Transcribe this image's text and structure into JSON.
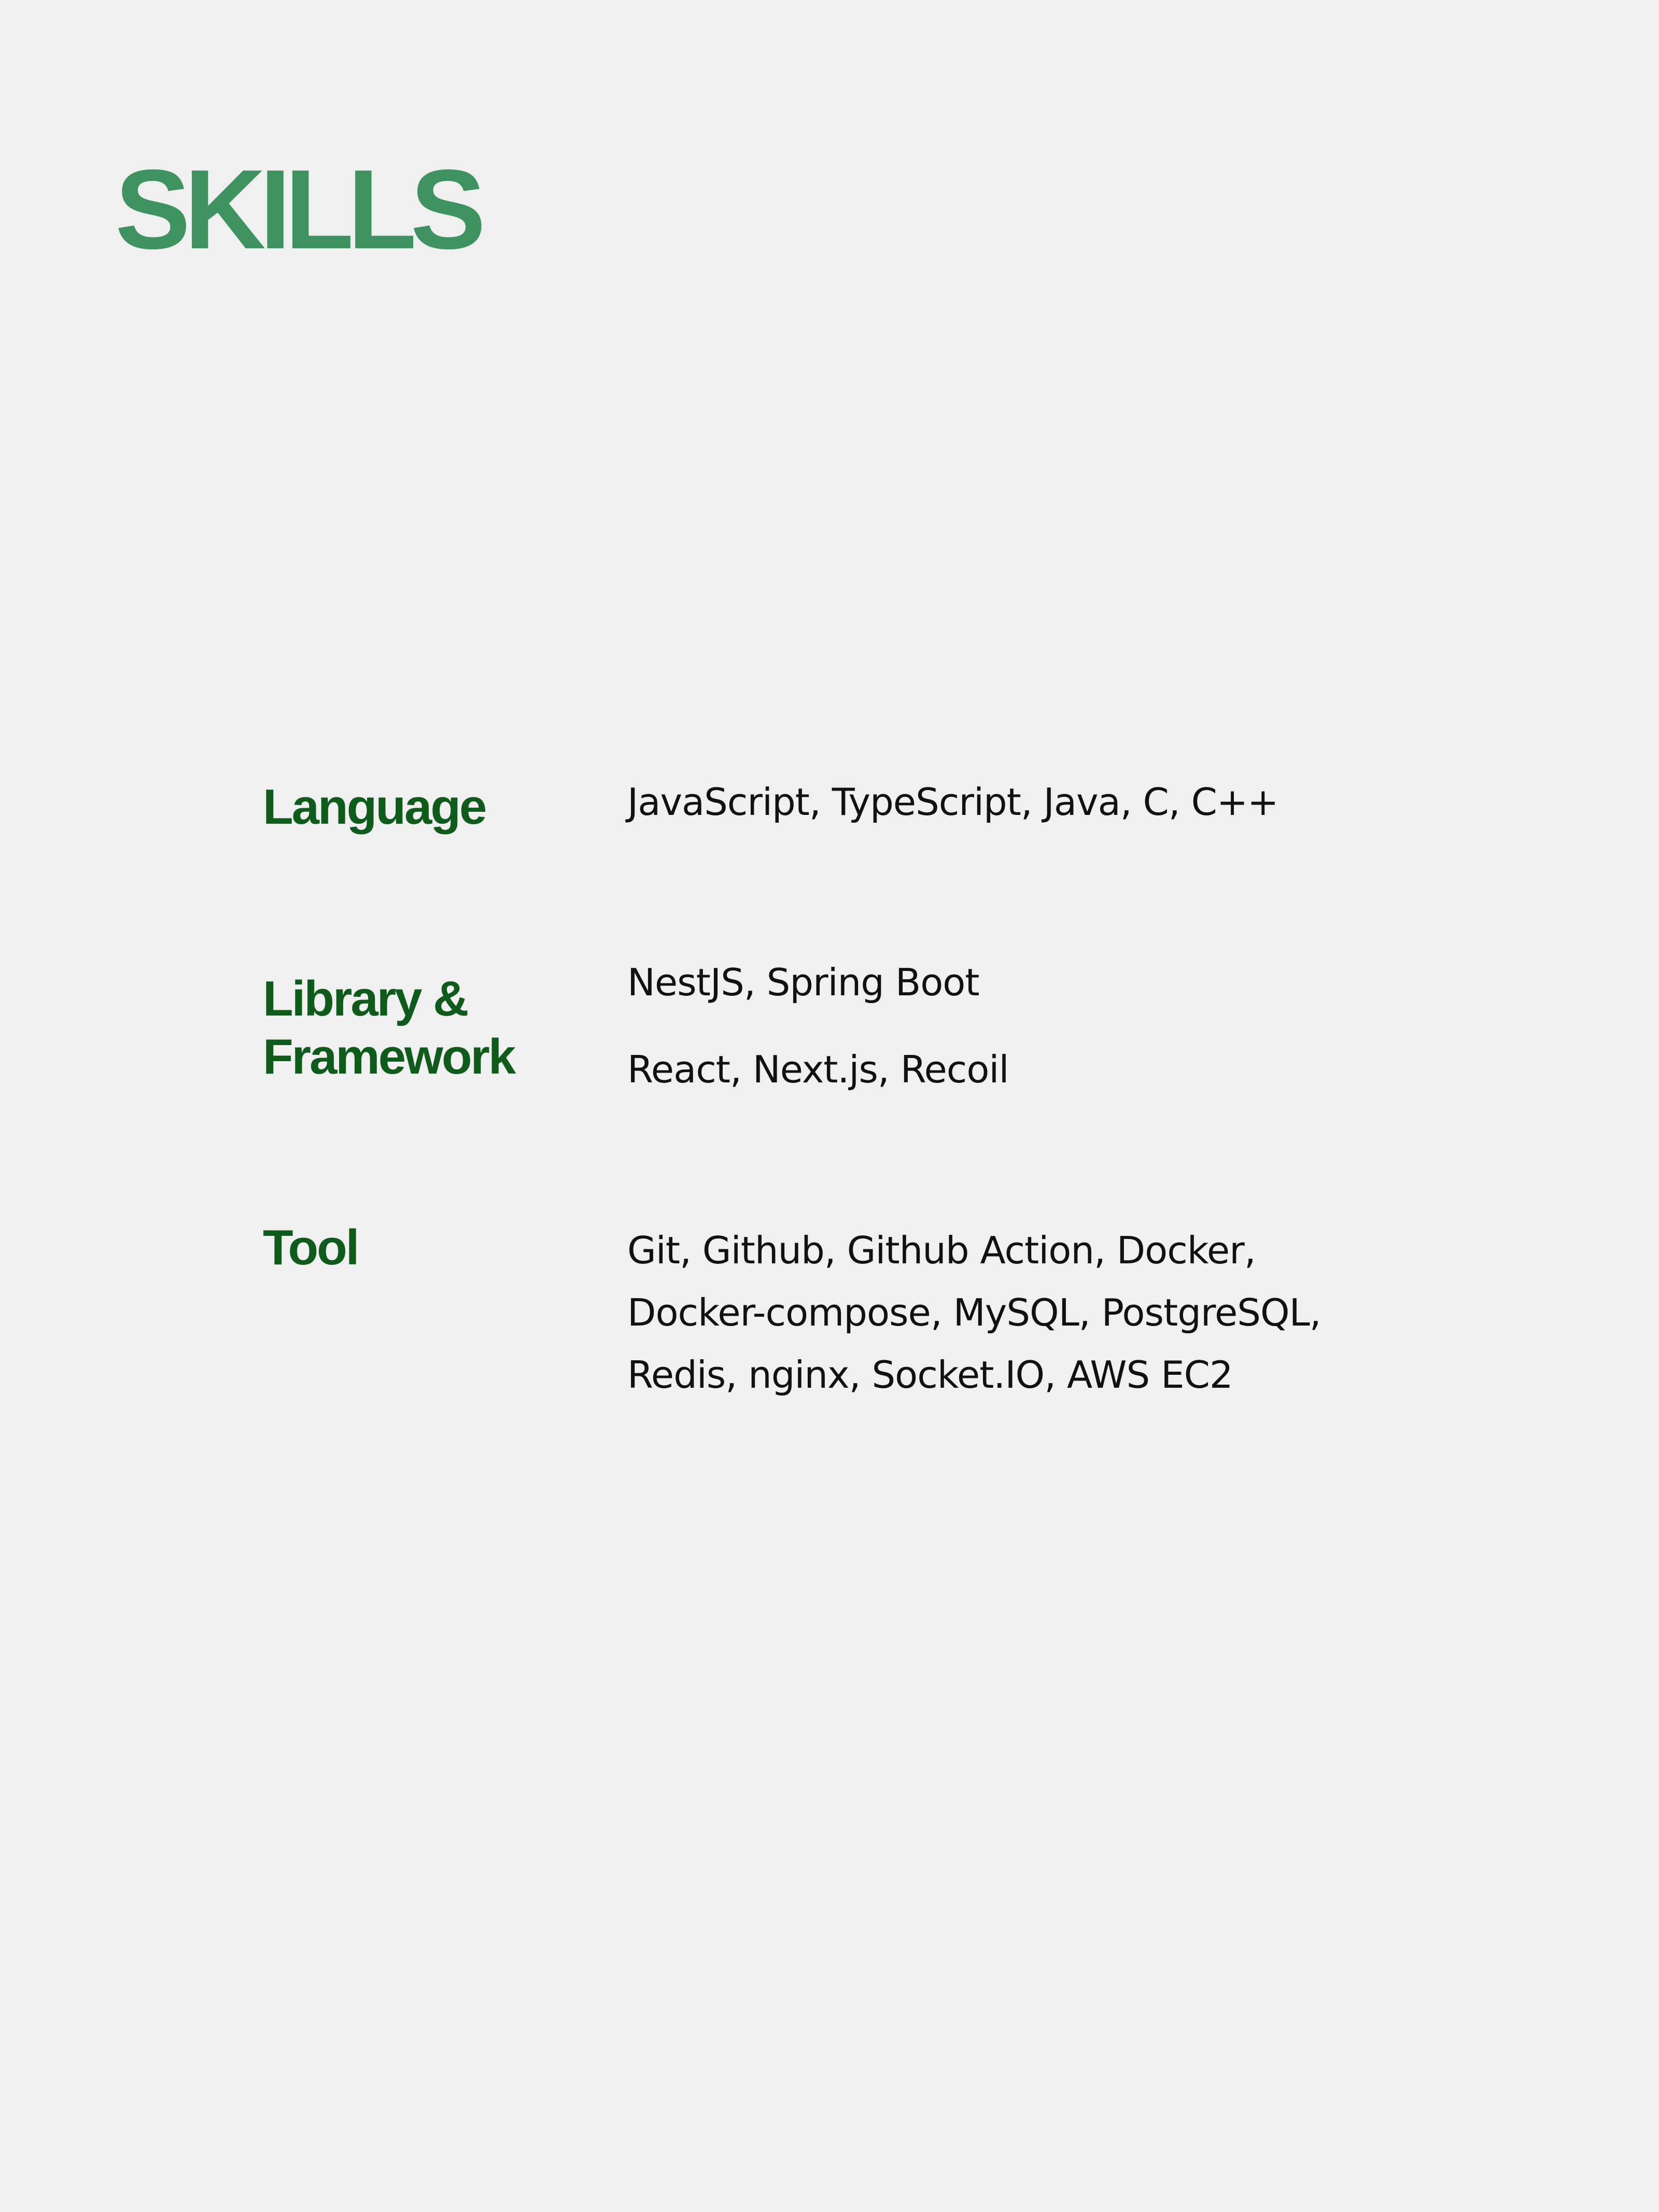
{
  "title": "SKILLS",
  "sections": {
    "language": {
      "label": "Language",
      "lines": [
        "JavaScript, TypeScript, Java, C, C++"
      ]
    },
    "library": {
      "label_line1": "Library &",
      "label_line2": "Framework",
      "lines": [
        "NestJS, Spring Boot",
        "React, Next.js, Recoil"
      ]
    },
    "tool": {
      "label": "Tool",
      "lines": [
        "Git, Github, Github Action, Docker,",
        "Docker-compose, MySQL, PostgreSQL,",
        "Redis, nginx, Socket.IO, AWS EC2"
      ]
    }
  },
  "colors": {
    "title": "#3e9360",
    "category": "#0e5b1b",
    "text": "#111111",
    "background": "#eff0ef"
  }
}
